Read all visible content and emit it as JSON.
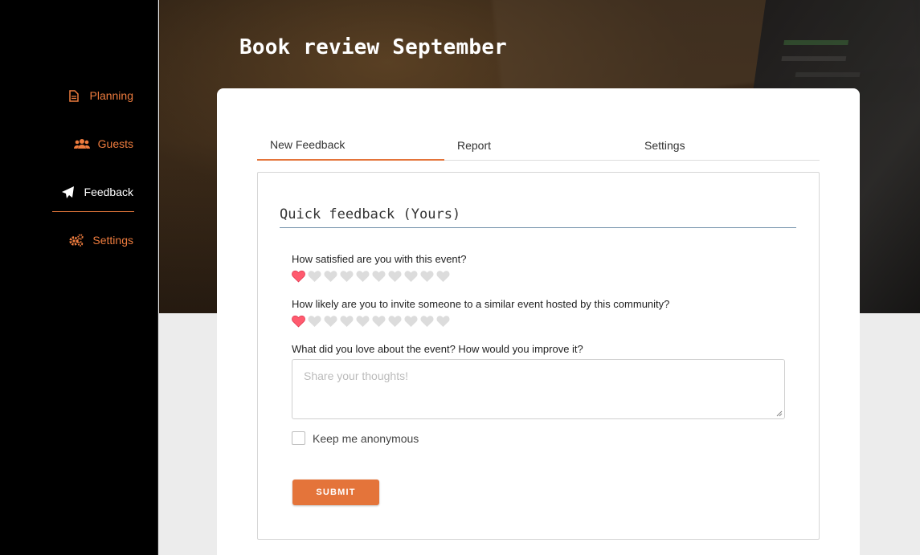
{
  "sidebar": {
    "items": [
      {
        "label": "Planning",
        "icon": "document-icon"
      },
      {
        "label": "Guests",
        "icon": "users-icon"
      },
      {
        "label": "Feedback",
        "icon": "paper-plane-icon",
        "active": true
      },
      {
        "label": "Settings",
        "icon": "gears-icon"
      }
    ]
  },
  "header": {
    "title": "Book review September"
  },
  "tabs": [
    {
      "label": "New Feedback",
      "active": true
    },
    {
      "label": "Report"
    },
    {
      "label": "Settings"
    }
  ],
  "form": {
    "title": "Quick feedback (Yours)",
    "q1": {
      "label": "How satisfied are you with this event?",
      "rating": 1,
      "max": 10
    },
    "q2": {
      "label": "How likely are you to invite someone to a similar event hosted by this community?",
      "rating": 1,
      "max": 10
    },
    "q3": {
      "label": "What did you love about the event? How would you improve it?",
      "placeholder": "Share your thoughts!"
    },
    "anonymous_label": "Keep me anonymous",
    "anonymous_checked": false,
    "submit_label": "SUBMIT"
  },
  "colors": {
    "accent": "#e4743a",
    "nav_orange": "#ee7c3e",
    "heart_active": "#ff5a6e",
    "heart_inactive": "#dcdcdc"
  }
}
